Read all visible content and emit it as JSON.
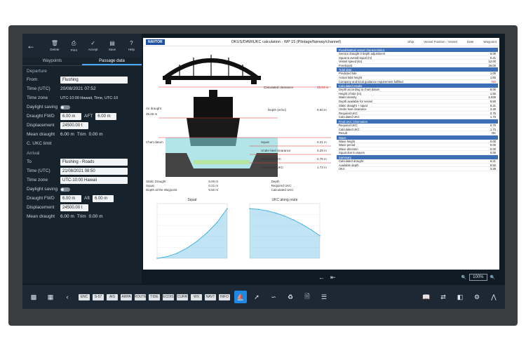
{
  "left_panel": {
    "toolbar": [
      {
        "icon": "trash-icon",
        "label": "Delete"
      },
      {
        "icon": "print-icon",
        "label": "Print"
      },
      {
        "icon": "checkmark-icon",
        "label": "Accept"
      },
      {
        "icon": "save-icon",
        "label": "Save"
      },
      {
        "icon": "help-icon",
        "label": "Help"
      }
    ],
    "tabs": [
      "Waypoints",
      "Passage data"
    ],
    "departure": {
      "section": "Departure",
      "from_label": "From",
      "from_value": "Flushing",
      "time_label": "Time (UTC)",
      "time_value": "20/08/2021 07:52",
      "zone_label": "Time zone",
      "zone_value": "UTC-10:00 Hawaii, Time, UTC-10",
      "daylight_label": "Daylight saving",
      "draught_label": "Draught FWD",
      "draught_fwd": "6.00 m",
      "aft_label": "AFT",
      "draught_aft": "6.00 m",
      "disp_label": "Displacement",
      "disp_value": "24500.00 t",
      "mean_label": "Mean draught",
      "mean_value": "6.00 m",
      "trim_label": "Trim",
      "trim_value": "0.00 m",
      "ukc_label": "C. UKC limit"
    },
    "arrival": {
      "section": "Arrival",
      "to_label": "To",
      "to_value": "Flushing - Roads",
      "time_label": "Time (UTC)",
      "time_value": "21/08/2021 08:50",
      "zone_label": "Time zone",
      "zone_value": "UTC-10:00 Hawaii",
      "daylight_label": "Daylight saving",
      "draught_label": "Draught FWD",
      "draught_fwd": "6.00 m",
      "aft_label": "Aft",
      "draught_aft": "6.00 m",
      "disp_label": "Displacement",
      "disp_value": "24500.00 t",
      "mean_label": "Mean draught",
      "mean_value": "6.00 m",
      "trim_label": "Trim",
      "trim_value": "0.00 m"
    }
  },
  "document": {
    "logo": "NAVTOR",
    "title": "OKUS/DAWIUKC calculation - WP 15 (Pilotage/fairway/channel)",
    "meta": [
      "Ship",
      "Vessel Position - Vessel",
      "Date",
      "Waypoint"
    ],
    "scene_labels": {
      "clearance": "Calculated clearance",
      "air_draught": "Air draught",
      "depth": "Depth (echo)",
      "chart": "Chart datum",
      "squat": "Squat",
      "ukc": "Under keel clearance",
      "required": "Required UKC",
      "calc": "Calculated UKC"
    },
    "scene_values": {
      "clearance": "15.24 m",
      "air_draught": "35.48 m",
      "depth": "9.50 m",
      "squat": "0.21 m",
      "ukc": "3.29 m",
      "required": "0.75 m",
      "calc": "1.73 m"
    },
    "ukc_table": [
      "Static Draught",
      "6.00 m",
      "Depth",
      "Squat",
      "0.21 m",
      "Required UKC",
      "Depth at the Waypoint",
      "9.50 m",
      "Calculated UKC"
    ],
    "plot_titles": [
      "Squat",
      "UKC along route"
    ]
  },
  "right_table": {
    "sections": [
      {
        "head": "Fixed/statical vessel characteristics",
        "rows": [
          [
            "Service draught 0 depth adjustment",
            "6.00"
          ],
          [
            "Squat & overall squat (m)",
            "0.21"
          ],
          [
            "Vessel speed (kn)",
            "12.00"
          ],
          [
            "Freeboard",
            "26.00"
          ]
        ]
      },
      {
        "head": "Tidal data",
        "rows": [
          [
            "Predicted tide",
            "1.00"
          ],
          [
            "Actual tidal height",
            "1.50"
          ],
          [
            "Company and local guidance requirement fulfilled",
            "NO"
          ]
        ]
      },
      {
        "head": "Calculated results",
        "rows": [
          [
            "Depth according to chart datum",
            "8.00"
          ],
          [
            "Height of tide (m)",
            "1.50"
          ],
          [
            "Water density",
            "1.025"
          ],
          [
            "Depth available for vessel",
            "9.50"
          ],
          [
            "Static draught + squat",
            "6.21"
          ],
          [
            "Under keel clearance",
            "3.29"
          ],
          [
            "Required UKC",
            "0.75"
          ],
          [
            "Calculated UKC",
            "1.73"
          ]
        ]
      },
      {
        "head": "Final UKC information",
        "rows": [
          [
            "Required UKC",
            "0.75"
          ],
          [
            "Calculated UKC",
            "1.73"
          ],
          [
            "Result",
            "OK"
          ]
        ]
      },
      {
        "head": "Wave",
        "rows": [
          [
            "Wave height",
            "0.00"
          ],
          [
            "Wave period",
            "0.00"
          ],
          [
            "Wave direction",
            "0.00"
          ],
          [
            "Squat due to waves",
            "0.00"
          ]
        ]
      },
      {
        "head": "Summary",
        "rows": [
          [
            "Calculated draught",
            "6.21"
          ],
          [
            "Available depth",
            "9.50"
          ],
          [
            "UKC",
            "3.29"
          ]
        ]
      }
    ]
  },
  "docbar": {
    "zoom_value": "100%"
  },
  "bottombar": {
    "chips": [
      "ENC",
      "S-57",
      "AIS",
      "ARPA",
      "ROUTE",
      "TIDE",
      "ECDIS",
      "CURR",
      "WX",
      "NAVT",
      "INFO"
    ]
  },
  "chart_data": [
    {
      "type": "area",
      "title": "Squat",
      "x": [
        0,
        2,
        4,
        6,
        8,
        10,
        12,
        14
      ],
      "values": [
        0,
        0.01,
        0.03,
        0.06,
        0.1,
        0.15,
        0.21,
        0.29
      ],
      "color": "#4ab3e0"
    },
    {
      "type": "area",
      "title": "UKC along route",
      "x": [
        0,
        1,
        2,
        3,
        4,
        5,
        6,
        7,
        8
      ],
      "values": [
        3.3,
        3.25,
        3.15,
        3.0,
        2.8,
        2.55,
        2.25,
        1.9,
        1.5
      ],
      "color": "#4ab3e0"
    }
  ]
}
